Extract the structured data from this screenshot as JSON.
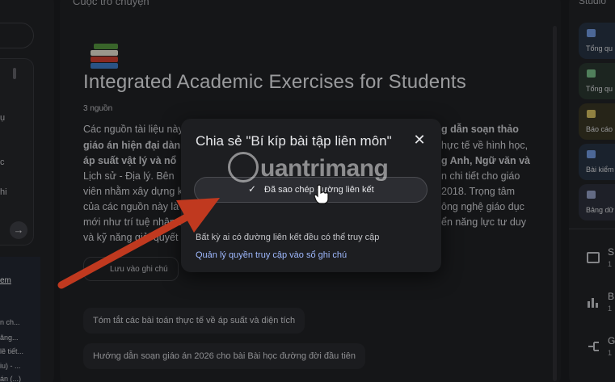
{
  "left": {
    "fragments": [
      "ụ",
      "c",
      "hi"
    ],
    "link": "em",
    "small_items": [
      "n ch...",
      "ăng...",
      "lẽ tiết...",
      "iu) - ...",
      "án (...)"
    ]
  },
  "main": {
    "header_title": "Cuộc trò chuyện",
    "title": "Integrated Academic Exercises for Students",
    "sources": "3 nguồn",
    "summary_lines": [
      {
        "left": "Các nguồn tài liệu này",
        "right": "g dẫn soạn thảo",
        "right_bold": true
      },
      {
        "left": "giáo án hiện đại dành",
        "left_bold": true,
        "right": "hực tế về hình học,"
      },
      {
        "left": "áp suất vật lý và nổ",
        "left_bold": true,
        "right": "g Anh, Ngữ văn và",
        "right_bold": true
      },
      {
        "left": "Lịch sử - Địa lý. Bên",
        "right": "n chi tiết cho giáo"
      },
      {
        "left": "viên nhằm xây dựng k",
        "right": "2018. Trọng tâm"
      },
      {
        "left": "của các nguồn này là",
        "right": "ông nghệ giáo dục"
      },
      {
        "left": "mới như trí tuệ nhân t",
        "right": "ển năng lực tư duy"
      },
      {
        "left": "và kỹ năng giải quyết",
        "right": ""
      }
    ],
    "save_note": "Lưu vào ghi chú",
    "suggestions": [
      "Tóm tắt các bài toán thực tế về áp suất và diện tích",
      "Hướng dẫn soạn giáo án 2026 cho bài Bài học đường đời đầu tiên"
    ]
  },
  "right": {
    "header_title": "Studio",
    "tiles": [
      {
        "label": "Tổng qu",
        "icon": "audio-wave-icon"
      },
      {
        "label": "Tổng qu",
        "icon": "video-icon"
      },
      {
        "label": "Báo cáo",
        "icon": "report-icon"
      },
      {
        "label": "Bài kiểm",
        "icon": "quiz-icon"
      },
      {
        "label": "Bảng dữ",
        "icon": "table-icon"
      }
    ],
    "items": [
      {
        "letter": "S",
        "sub": "1",
        "icon": "slides-icon"
      },
      {
        "letter": "B",
        "sub": "1",
        "icon": "chart-icon"
      },
      {
        "letter": "G",
        "sub": "1",
        "icon": "mindmap-icon"
      }
    ]
  },
  "dialog": {
    "title": "Chia sẻ \"Bí kíp bài tập liên môn\"",
    "close": "✕",
    "copied_label": "Đã sao chép đường liên kết",
    "check": "✓",
    "access_text": "Bất kỳ ai có đường liên kết đều có thể truy cập",
    "manage_link": "Quản lý quyền truy cập vào sổ ghi chú"
  },
  "watermark": {
    "text": "uantrimang"
  },
  "colors": {
    "accent_link": "#9fb9ff",
    "arrow": "#c0391f",
    "background": "#1a1b1e"
  }
}
